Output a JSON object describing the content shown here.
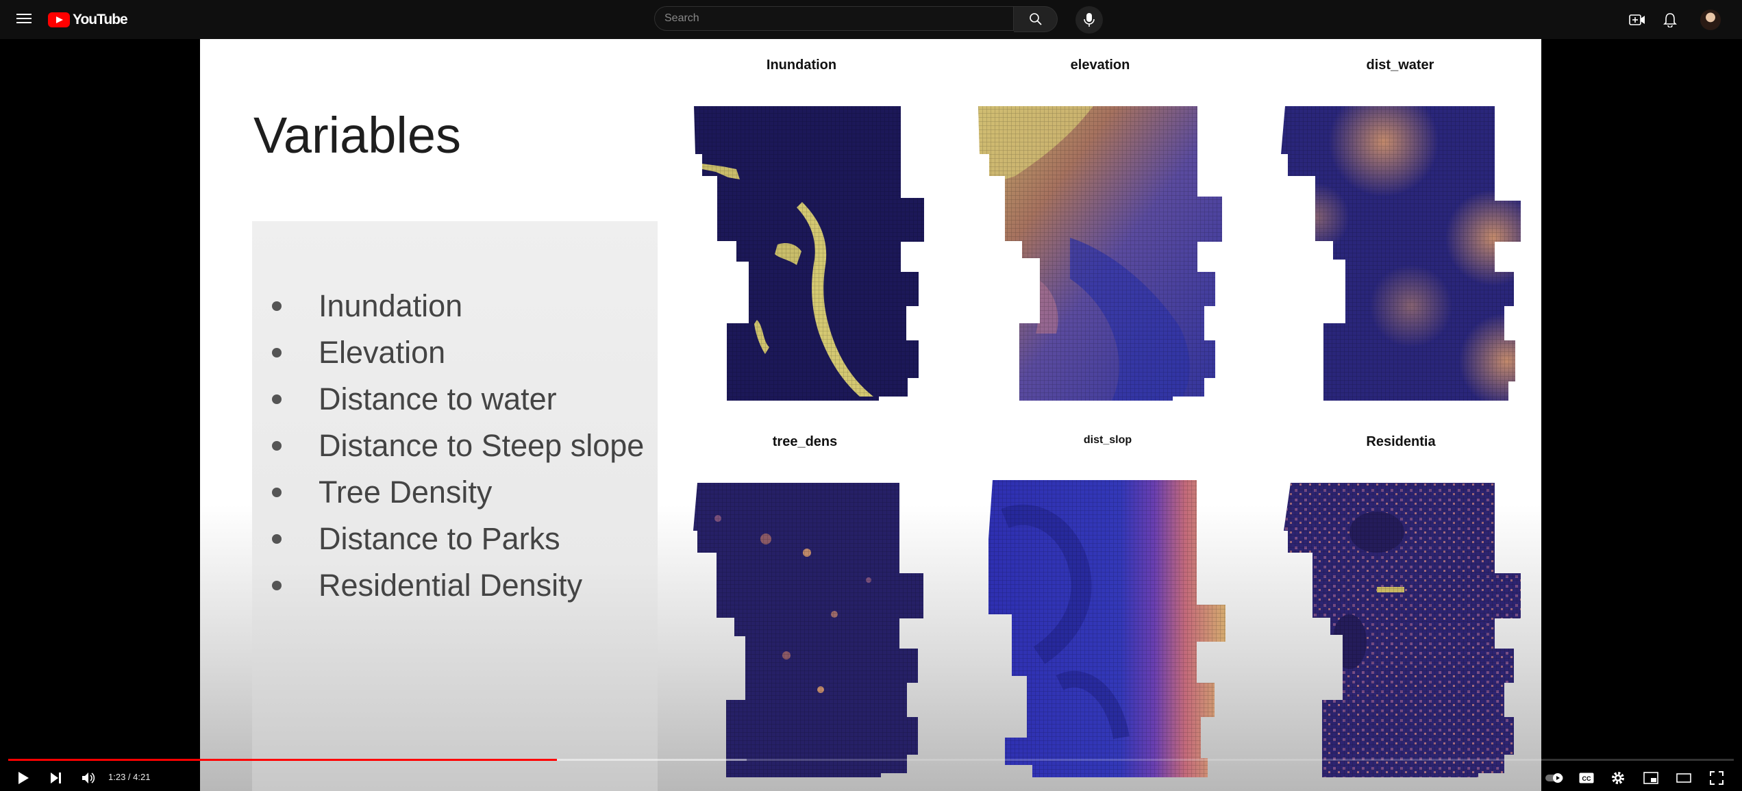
{
  "header": {
    "logo_text": "YouTube",
    "search_placeholder": "Search",
    "icons": [
      "menu-icon",
      "search-icon",
      "mic-icon",
      "create-icon",
      "bell-icon",
      "avatar"
    ]
  },
  "slide": {
    "title": "Variables",
    "bullets": [
      "Inundation",
      "Elevation",
      "Distance to water",
      "Distance to Steep slope",
      "Tree Density",
      "Distance to Parks",
      "Residential Density"
    ],
    "maps": [
      {
        "label": "Inundation"
      },
      {
        "label": "elevation"
      },
      {
        "label": "dist_water"
      },
      {
        "label": "tree_dens"
      },
      {
        "label": "dist_slop"
      },
      {
        "label": "Residentia"
      }
    ]
  },
  "player": {
    "current_time": "1:23",
    "duration": "4:21",
    "time_display": "1:23 / 4:21",
    "played_fraction": 0.318,
    "buffered_fraction": 0.428
  },
  "colors": {
    "progress_played": "#ff0000",
    "map_dark": "#1b1656",
    "map_mid": "#3a3dbc",
    "map_warm": "#c47b63",
    "map_hot": "#d9c46a",
    "brand_red": "#ff0000"
  }
}
